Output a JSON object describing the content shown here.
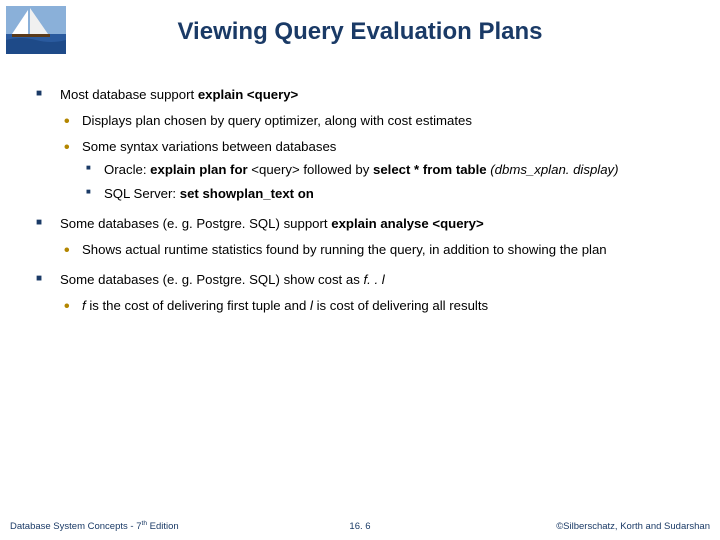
{
  "title": "Viewing Query Evaluation Plans",
  "bullets": {
    "b1_pre": "Most database support  ",
    "b1_bold": "explain <query>",
    "b1_1": "Displays plan chosen by query optimizer, along with cost estimates",
    "b1_2": "Some syntax variations between databases",
    "b1_2_1_pre": "Oracle:  ",
    "b1_2_1_bold1": "explain plan for ",
    "b1_2_1_mid": "<query> followed by ",
    "b1_2_1_bold2": "select * from table",
    "b1_2_1_italic": " (dbms_xplan. display)",
    "b1_2_2_pre": "SQL Server:  ",
    "b1_2_2_bold": "set showplan_text on",
    "b2_pre": "Some databases (e. g. Postgre. SQL) support  ",
    "b2_bold": "explain analyse <query>",
    "b2_1": "Shows actual runtime statistics found by running the query, in addition to showing the plan",
    "b3_pre": "Some databases (e. g. Postgre. SQL) show cost as   ",
    "b3_italic": "f. . l",
    "b3_1_pre": "",
    "b3_1_i1": "f",
    "b3_1_mid1": " is the cost of delivering first tuple and ",
    "b3_1_i2": "l",
    "b3_1_mid2": " is cost of delivering all results"
  },
  "footer": {
    "left_pre": "Database System Concepts - 7",
    "left_sup": "th",
    "left_post": " Edition",
    "center": "16. 6",
    "right": "©Silberschatz, Korth and Sudarshan"
  }
}
